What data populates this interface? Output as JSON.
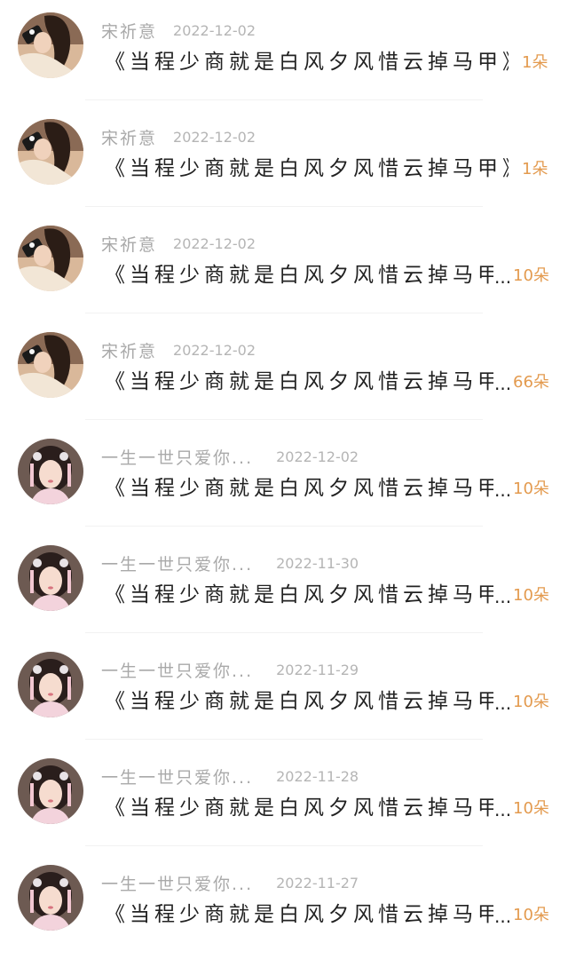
{
  "items": [
    {
      "username": "宋祈意",
      "date": "2022-12-02",
      "title": "《当程少商就是白风夕风惜云掉马甲》",
      "truncated": false,
      "count": "1朵",
      "avatar": "avatar-girl-photo"
    },
    {
      "username": "宋祈意",
      "date": "2022-12-02",
      "title": "《当程少商就是白风夕风惜云掉马甲》",
      "truncated": false,
      "count": "1朵",
      "avatar": "avatar-girl-photo"
    },
    {
      "username": "宋祈意",
      "date": "2022-12-02",
      "title": "《当程少商就是白风夕风惜云掉马甲",
      "truncated": true,
      "ellipsis": "...",
      "count": "10朵",
      "avatar": "avatar-girl-photo"
    },
    {
      "username": "宋祈意",
      "date": "2022-12-02",
      "title": "《当程少商就是白风夕风惜云掉马甲",
      "truncated": true,
      "ellipsis": "...",
      "count": "66朵",
      "avatar": "avatar-girl-photo"
    },
    {
      "username": "一生一世只爱你...",
      "date": "2022-12-02",
      "title": "《当程少商就是白风夕风惜云掉马甲",
      "truncated": true,
      "ellipsis": "...",
      "count": "10朵",
      "avatar": "avatar-costume-girl"
    },
    {
      "username": "一生一世只爱你...",
      "date": "2022-11-30",
      "title": "《当程少商就是白风夕风惜云掉马甲",
      "truncated": true,
      "ellipsis": "...",
      "count": "10朵",
      "avatar": "avatar-costume-girl"
    },
    {
      "username": "一生一世只爱你...",
      "date": "2022-11-29",
      "title": "《当程少商就是白风夕风惜云掉马甲",
      "truncated": true,
      "ellipsis": "...",
      "count": "10朵",
      "avatar": "avatar-costume-girl"
    },
    {
      "username": "一生一世只爱你...",
      "date": "2022-11-28",
      "title": "《当程少商就是白风夕风惜云掉马甲",
      "truncated": true,
      "ellipsis": "...",
      "count": "10朵",
      "avatar": "avatar-costume-girl"
    },
    {
      "username": "一生一世只爱你...",
      "date": "2022-11-27",
      "title": "《当程少商就是白风夕风惜云掉马甲",
      "truncated": true,
      "ellipsis": "...",
      "count": "10朵",
      "avatar": "avatar-costume-girl"
    }
  ],
  "colors": {
    "count": "#e39a4e",
    "username": "#a9a9a9",
    "date": "#b5b5b5",
    "title": "#222222"
  }
}
